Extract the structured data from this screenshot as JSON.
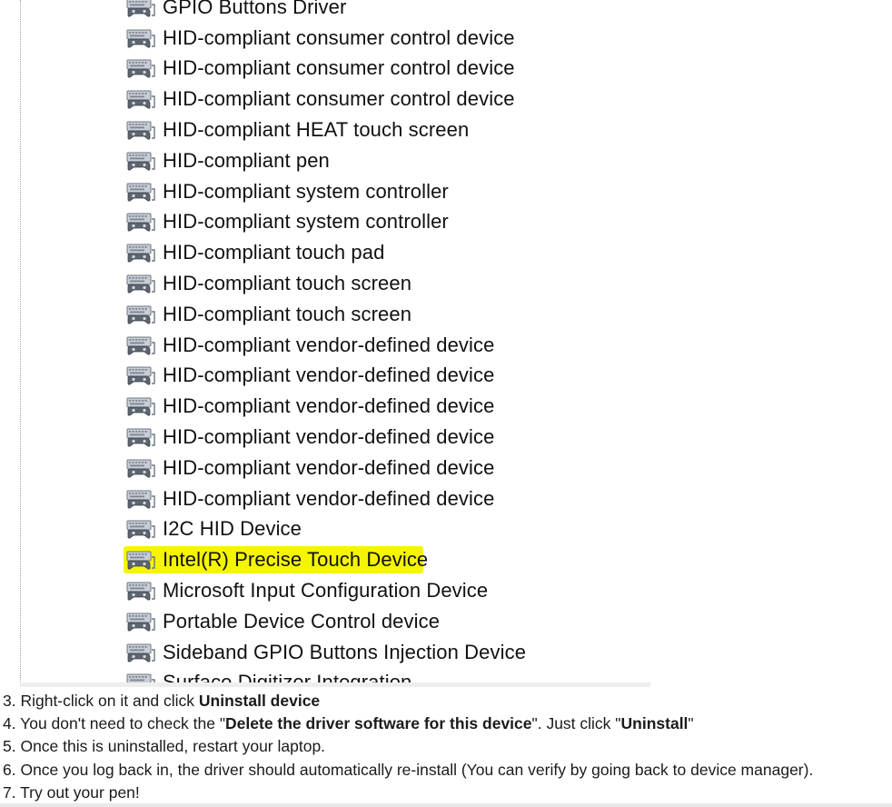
{
  "devices": [
    {
      "label": "GPIO Buttons Driver",
      "icon": "hid-device-icon",
      "highlighted": false
    },
    {
      "label": "HID-compliant consumer control device",
      "icon": "hid-device-icon",
      "highlighted": false
    },
    {
      "label": "HID-compliant consumer control device",
      "icon": "hid-device-icon",
      "highlighted": false
    },
    {
      "label": "HID-compliant consumer control device",
      "icon": "hid-device-icon",
      "highlighted": false
    },
    {
      "label": "HID-compliant HEAT touch screen",
      "icon": "hid-device-icon",
      "highlighted": false
    },
    {
      "label": "HID-compliant pen",
      "icon": "hid-device-icon",
      "highlighted": false
    },
    {
      "label": "HID-compliant system controller",
      "icon": "hid-device-icon",
      "highlighted": false
    },
    {
      "label": "HID-compliant system controller",
      "icon": "hid-device-icon",
      "highlighted": false
    },
    {
      "label": "HID-compliant touch pad",
      "icon": "hid-device-icon",
      "highlighted": false
    },
    {
      "label": "HID-compliant touch screen",
      "icon": "hid-device-icon",
      "highlighted": false
    },
    {
      "label": "HID-compliant touch screen",
      "icon": "hid-device-icon",
      "highlighted": false
    },
    {
      "label": "HID-compliant vendor-defined device",
      "icon": "hid-device-icon",
      "highlighted": false
    },
    {
      "label": "HID-compliant vendor-defined device",
      "icon": "hid-device-icon",
      "highlighted": false
    },
    {
      "label": "HID-compliant vendor-defined device",
      "icon": "hid-device-icon",
      "highlighted": false
    },
    {
      "label": "HID-compliant vendor-defined device",
      "icon": "hid-device-icon",
      "highlighted": false
    },
    {
      "label": "HID-compliant vendor-defined device",
      "icon": "hid-device-icon",
      "highlighted": false
    },
    {
      "label": "HID-compliant vendor-defined device",
      "icon": "hid-device-icon",
      "highlighted": false
    },
    {
      "label": "I2C HID Device",
      "icon": "hid-device-icon",
      "highlighted": false
    },
    {
      "label": "Intel(R) Precise Touch Device",
      "icon": "hid-device-icon",
      "highlighted": true
    },
    {
      "label": "Microsoft Input Configuration Device",
      "icon": "hid-device-icon",
      "highlighted": false
    },
    {
      "label": "Portable Device Control device",
      "icon": "hid-device-icon",
      "highlighted": false
    },
    {
      "label": "Sideband GPIO Buttons Injection Device",
      "icon": "hid-device-icon",
      "highlighted": false
    },
    {
      "label": "Surface Digitizer Integration",
      "icon": "hid-device-icon",
      "highlighted": false
    }
  ],
  "highlight_color": "#f5f500",
  "steps": [
    {
      "prefix": "3. Right-click on it and click ",
      "bold1": "Uninstall device",
      "middle": "",
      "bold2": "",
      "suffix": ""
    },
    {
      "prefix": "4. You don't need to check the \"",
      "bold1": "Delete the driver software for this device",
      "middle": "\".  Just click \"",
      "bold2": "Uninstall",
      "suffix": "\""
    },
    {
      "prefix": "5. Once this is uninstalled, restart your laptop.",
      "bold1": "",
      "middle": "",
      "bold2": "",
      "suffix": ""
    },
    {
      "prefix": "6. Once you log back in, the driver should automatically re-install (You can verify by going back to device manager).",
      "bold1": "",
      "middle": "",
      "bold2": "",
      "suffix": ""
    },
    {
      "prefix": "7. Try out your pen!",
      "bold1": "",
      "middle": "",
      "bold2": "",
      "suffix": ""
    }
  ]
}
